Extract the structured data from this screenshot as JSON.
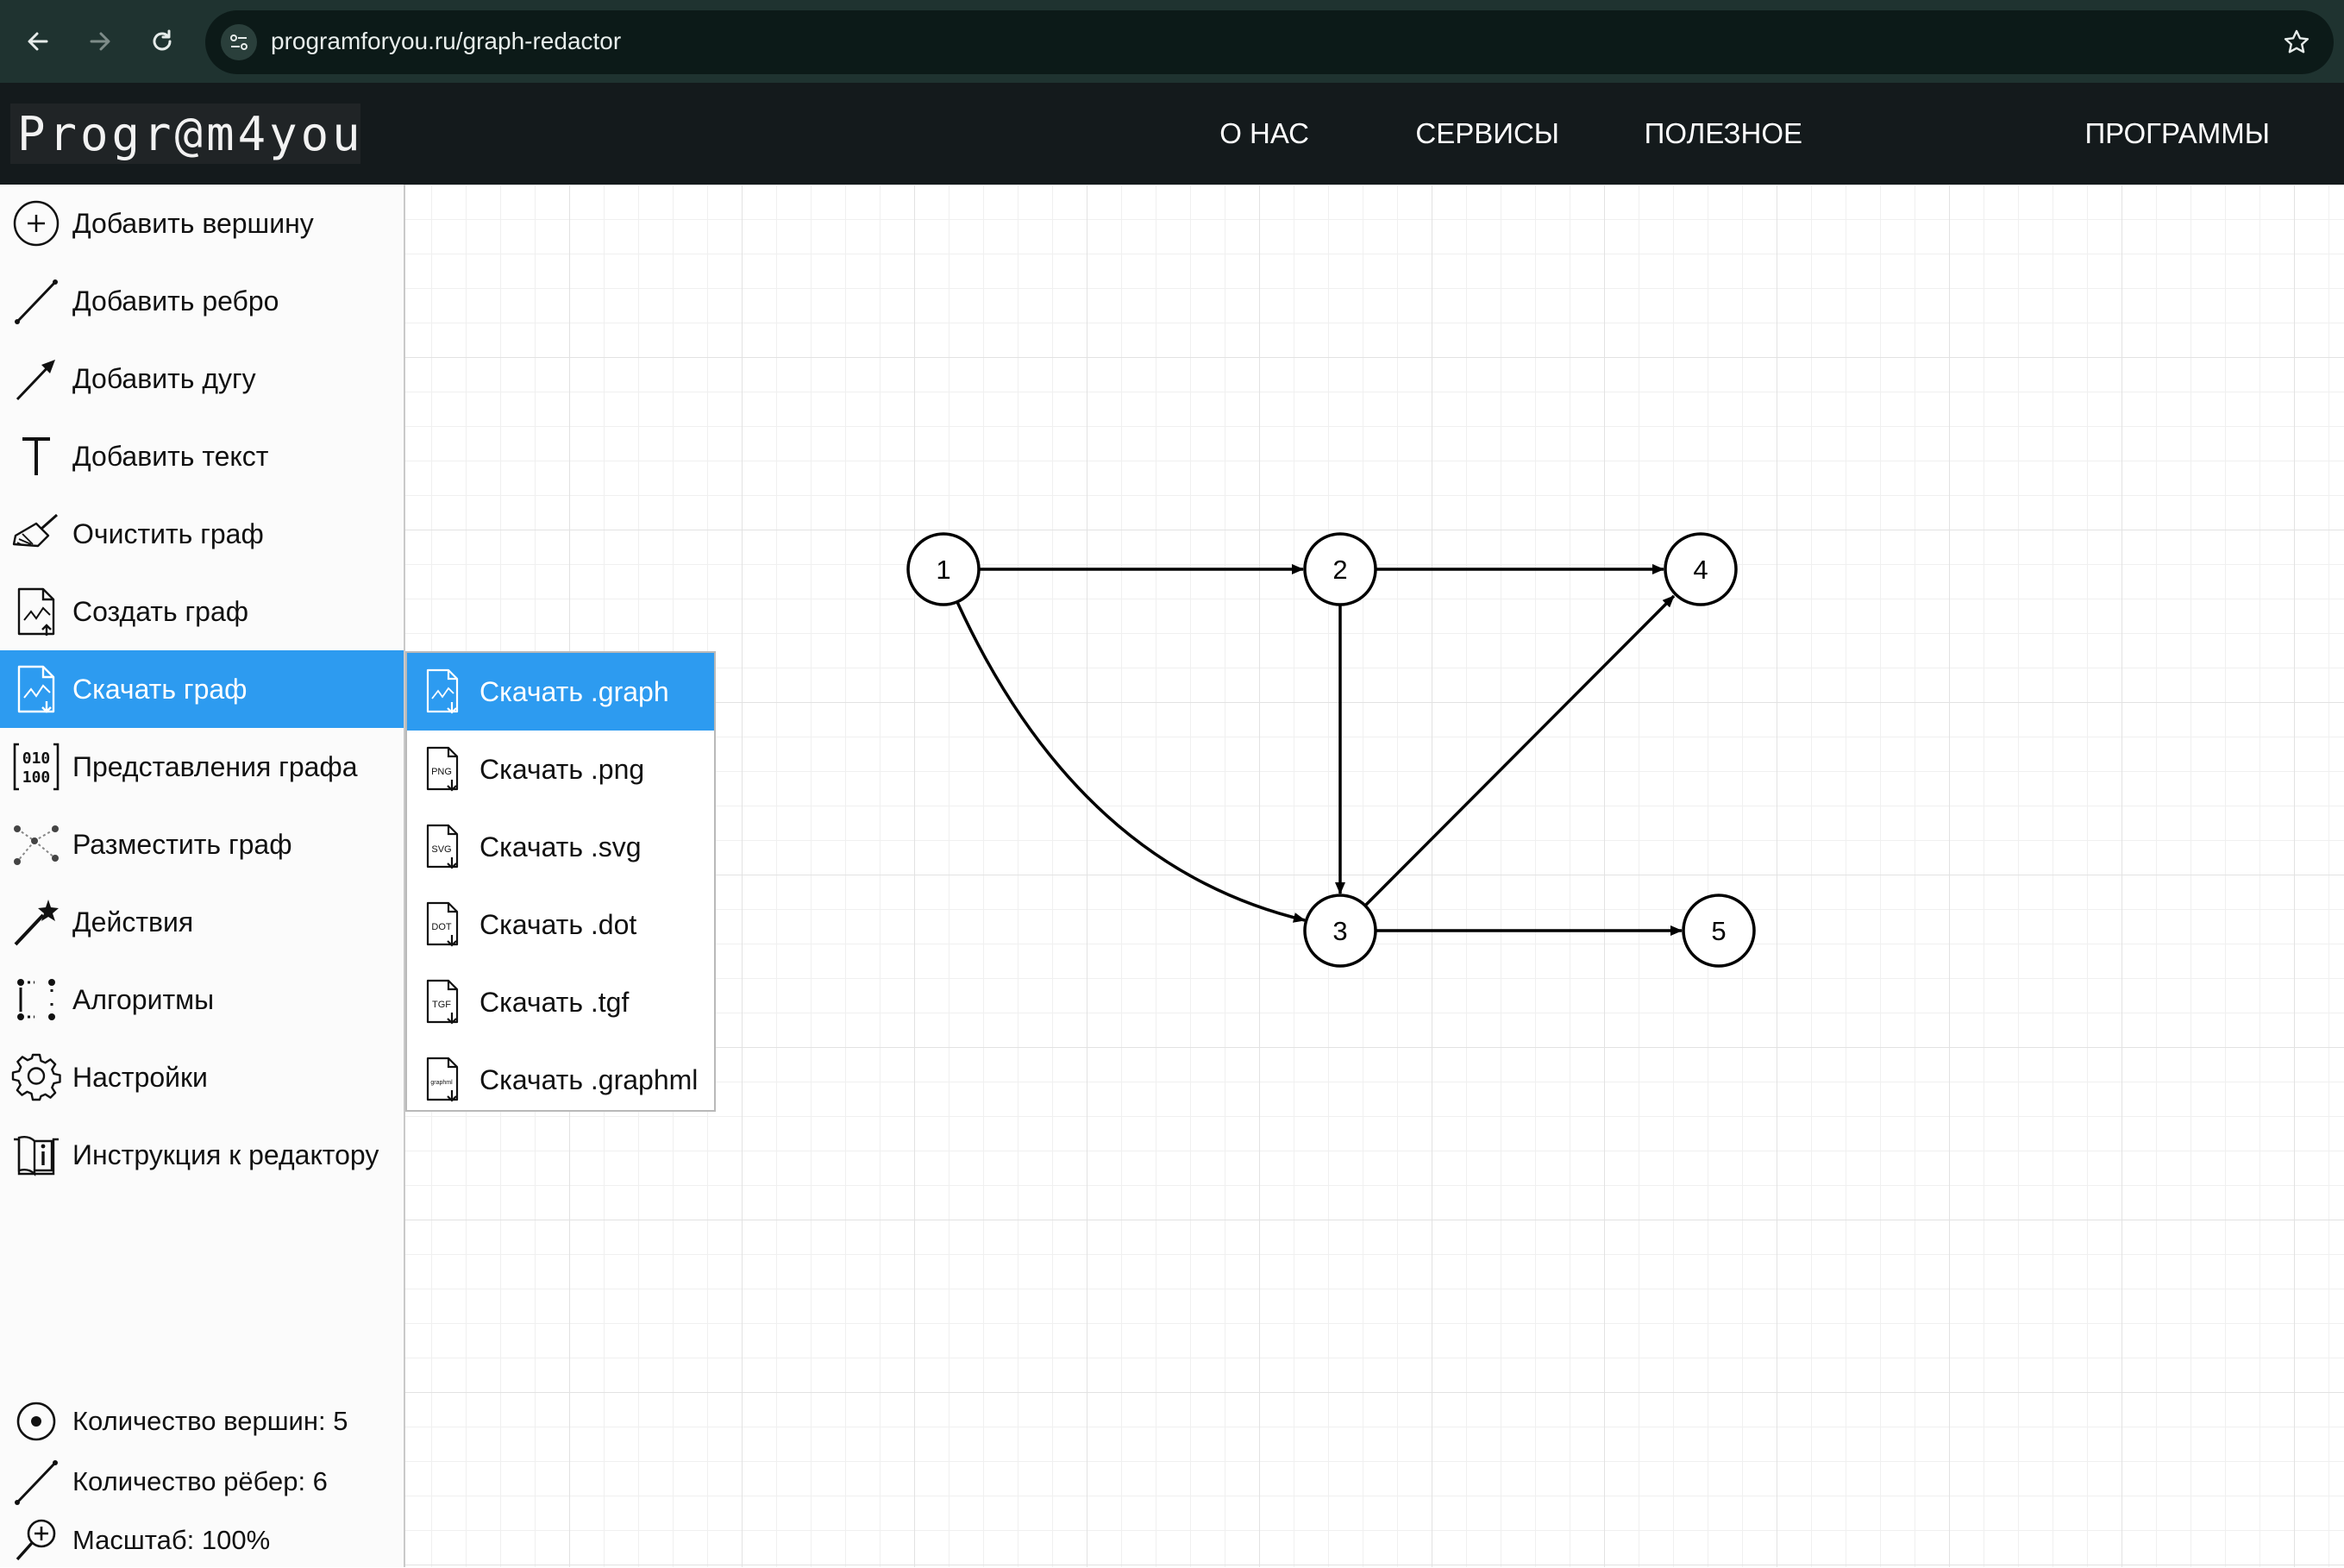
{
  "browser": {
    "url": "programforyou.ru/graph-redactor",
    "icons": [
      "back-arrow-icon",
      "forward-arrow-icon",
      "reload-icon",
      "site-settings-icon",
      "bookmark-star-icon"
    ]
  },
  "header": {
    "logo": "Progr@m4you",
    "nav": [
      "О НАС",
      "СЕРВИСЫ",
      "ПОЛЕЗНОЕ",
      "ПРОГРАММЫ"
    ]
  },
  "sidebar": {
    "items": [
      {
        "label": "Добавить вершину",
        "icon": "add-vertex-icon"
      },
      {
        "label": "Добавить ребро",
        "icon": "add-edge-icon"
      },
      {
        "label": "Добавить дугу",
        "icon": "add-arc-icon"
      },
      {
        "label": "Добавить текст",
        "icon": "add-text-icon"
      },
      {
        "label": "Очистить граф",
        "icon": "broom-icon"
      },
      {
        "label": "Создать граф",
        "icon": "create-graph-icon"
      },
      {
        "label": "Скачать граф",
        "icon": "download-graph-icon",
        "active": true
      },
      {
        "label": "Представления графа",
        "icon": "binary-matrix-icon"
      },
      {
        "label": "Разместить граф",
        "icon": "layout-graph-icon"
      },
      {
        "label": "Действия",
        "icon": "magic-wand-icon"
      },
      {
        "label": "Алгоритмы",
        "icon": "algorithms-icon"
      },
      {
        "label": "Настройки",
        "icon": "gear-icon"
      },
      {
        "label": "Инструкция к редактору",
        "icon": "book-info-icon"
      }
    ],
    "stats": {
      "vertices": "Количество вершин: 5",
      "edges": "Количество рёбер: 6",
      "zoom": "Масштаб: 100%"
    }
  },
  "download_menu": {
    "items": [
      {
        "label": "Скачать .graph",
        "badge": "",
        "active": true
      },
      {
        "label": "Скачать .png",
        "badge": "PNG"
      },
      {
        "label": "Скачать .svg",
        "badge": "SVG"
      },
      {
        "label": "Скачать .dot",
        "badge": "DOT"
      },
      {
        "label": "Скачать .tgf",
        "badge": "TGF"
      },
      {
        "label": "Скачать .graphml",
        "badge": "graphml"
      }
    ]
  },
  "graph": {
    "nodes": [
      "1",
      "2",
      "3",
      "4",
      "5"
    ],
    "edges": [
      {
        "from": "1",
        "to": "2",
        "directed": true
      },
      {
        "from": "1",
        "to": "3",
        "directed": true,
        "curved": true
      },
      {
        "from": "2",
        "to": "4",
        "directed": true
      },
      {
        "from": "2",
        "to": "3",
        "directed": true
      },
      {
        "from": "3",
        "to": "4",
        "directed": true
      },
      {
        "from": "3",
        "to": "5",
        "directed": true
      }
    ]
  },
  "colors": {
    "accent": "#2d9bf0",
    "header_bg": "#141a1c",
    "browser_bg": "#1f3330"
  }
}
